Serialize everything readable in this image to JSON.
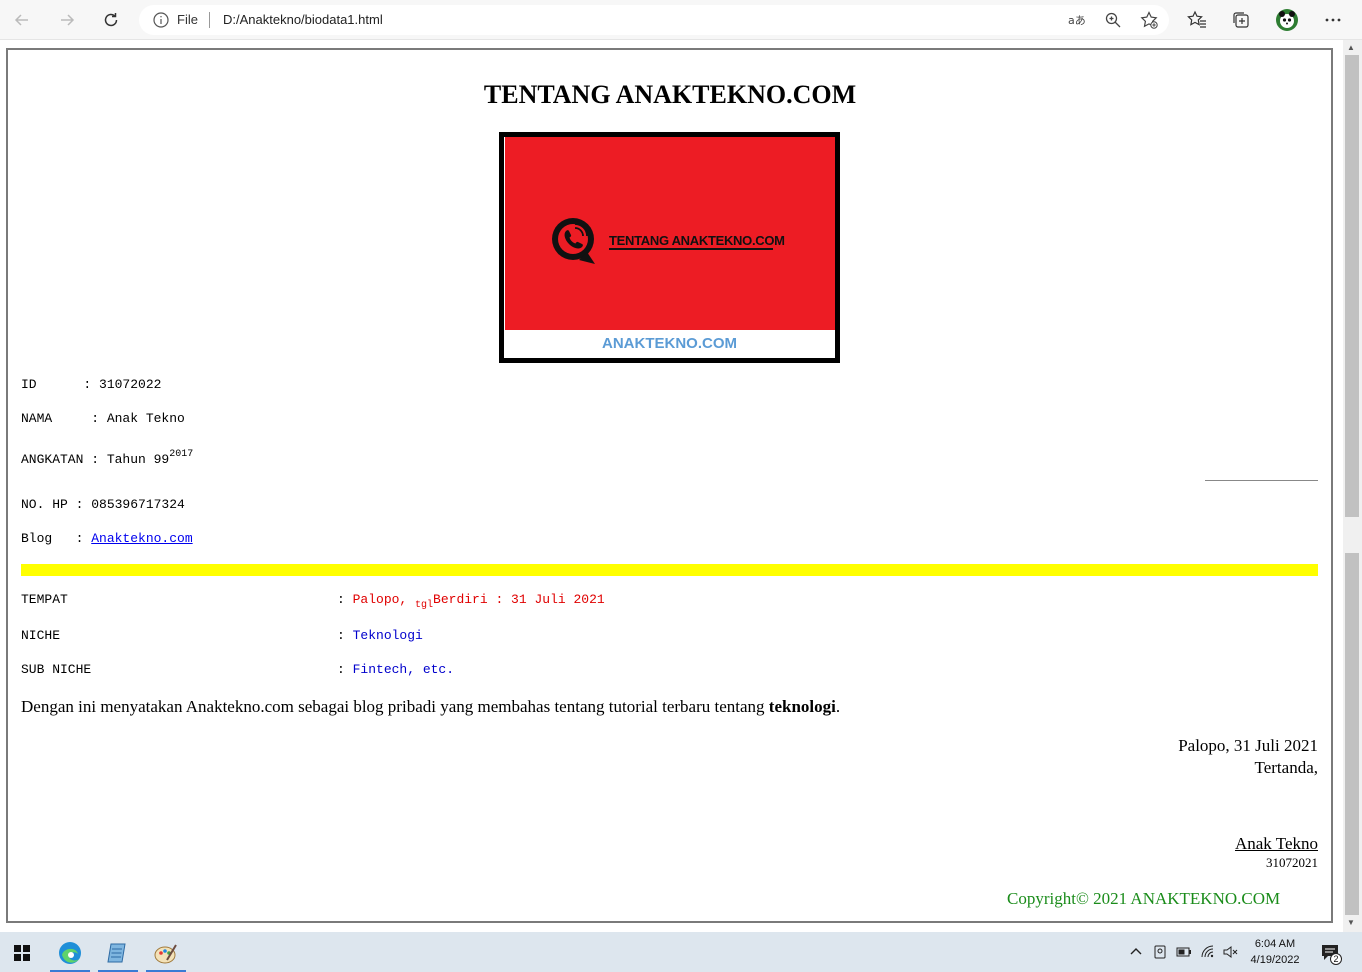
{
  "browser": {
    "file_label": "File",
    "url": "D:/Anaktekno/biodata1.html"
  },
  "page": {
    "title": "TENTANG ANAKTEKNO.COM",
    "logo": {
      "main_text": "TENTANG ANAKTEKNO.COM",
      "bottom_text": "ANAKTEKNO.COM"
    },
    "bio": {
      "id_label": "ID      : ",
      "id_value": "31072022",
      "nama_label": "NAMA     : ",
      "nama_value": "Anak Tekno",
      "angkatan_label": "ANGKATAN : ",
      "angkatan_value": "Tahun 99",
      "angkatan_sup": "2017",
      "hp_label": "NO. HP : ",
      "hp_value": "085396717324",
      "blog_label": "Blog   : ",
      "blog_value": "Anaktekno.com"
    },
    "details": {
      "tempat_label": "TEMPAT",
      "tempat_colon": ": ",
      "tempat_value": "Palopo, ",
      "tgl_sub": "tgl",
      "berdiri_value": "Berdiri : 31 Juli 2021",
      "niche_label": "NICHE",
      "niche_colon": ": ",
      "niche_value": "Teknologi",
      "subniche_label": "SUB NICHE",
      "subniche_colon": ": ",
      "subniche_value": "Fintech, etc."
    },
    "statement_pre": "Dengan ini menyatakan Anaktekno.com sebagai blog pribadi yang membahas tentang tutorial terbaru tentang ",
    "statement_bold": "teknologi",
    "statement_post": ".",
    "signature": {
      "place_date": "Palopo, 31 Juli 2021",
      "tertanda": "Tertanda,",
      "name": "Anak Tekno",
      "number": "31072021"
    },
    "copyright": "Copyright© 2021 ANAKTEKNO.COM"
  },
  "taskbar": {
    "time": "6:04 AM",
    "date": "4/19/2022",
    "notification_count": "2"
  }
}
